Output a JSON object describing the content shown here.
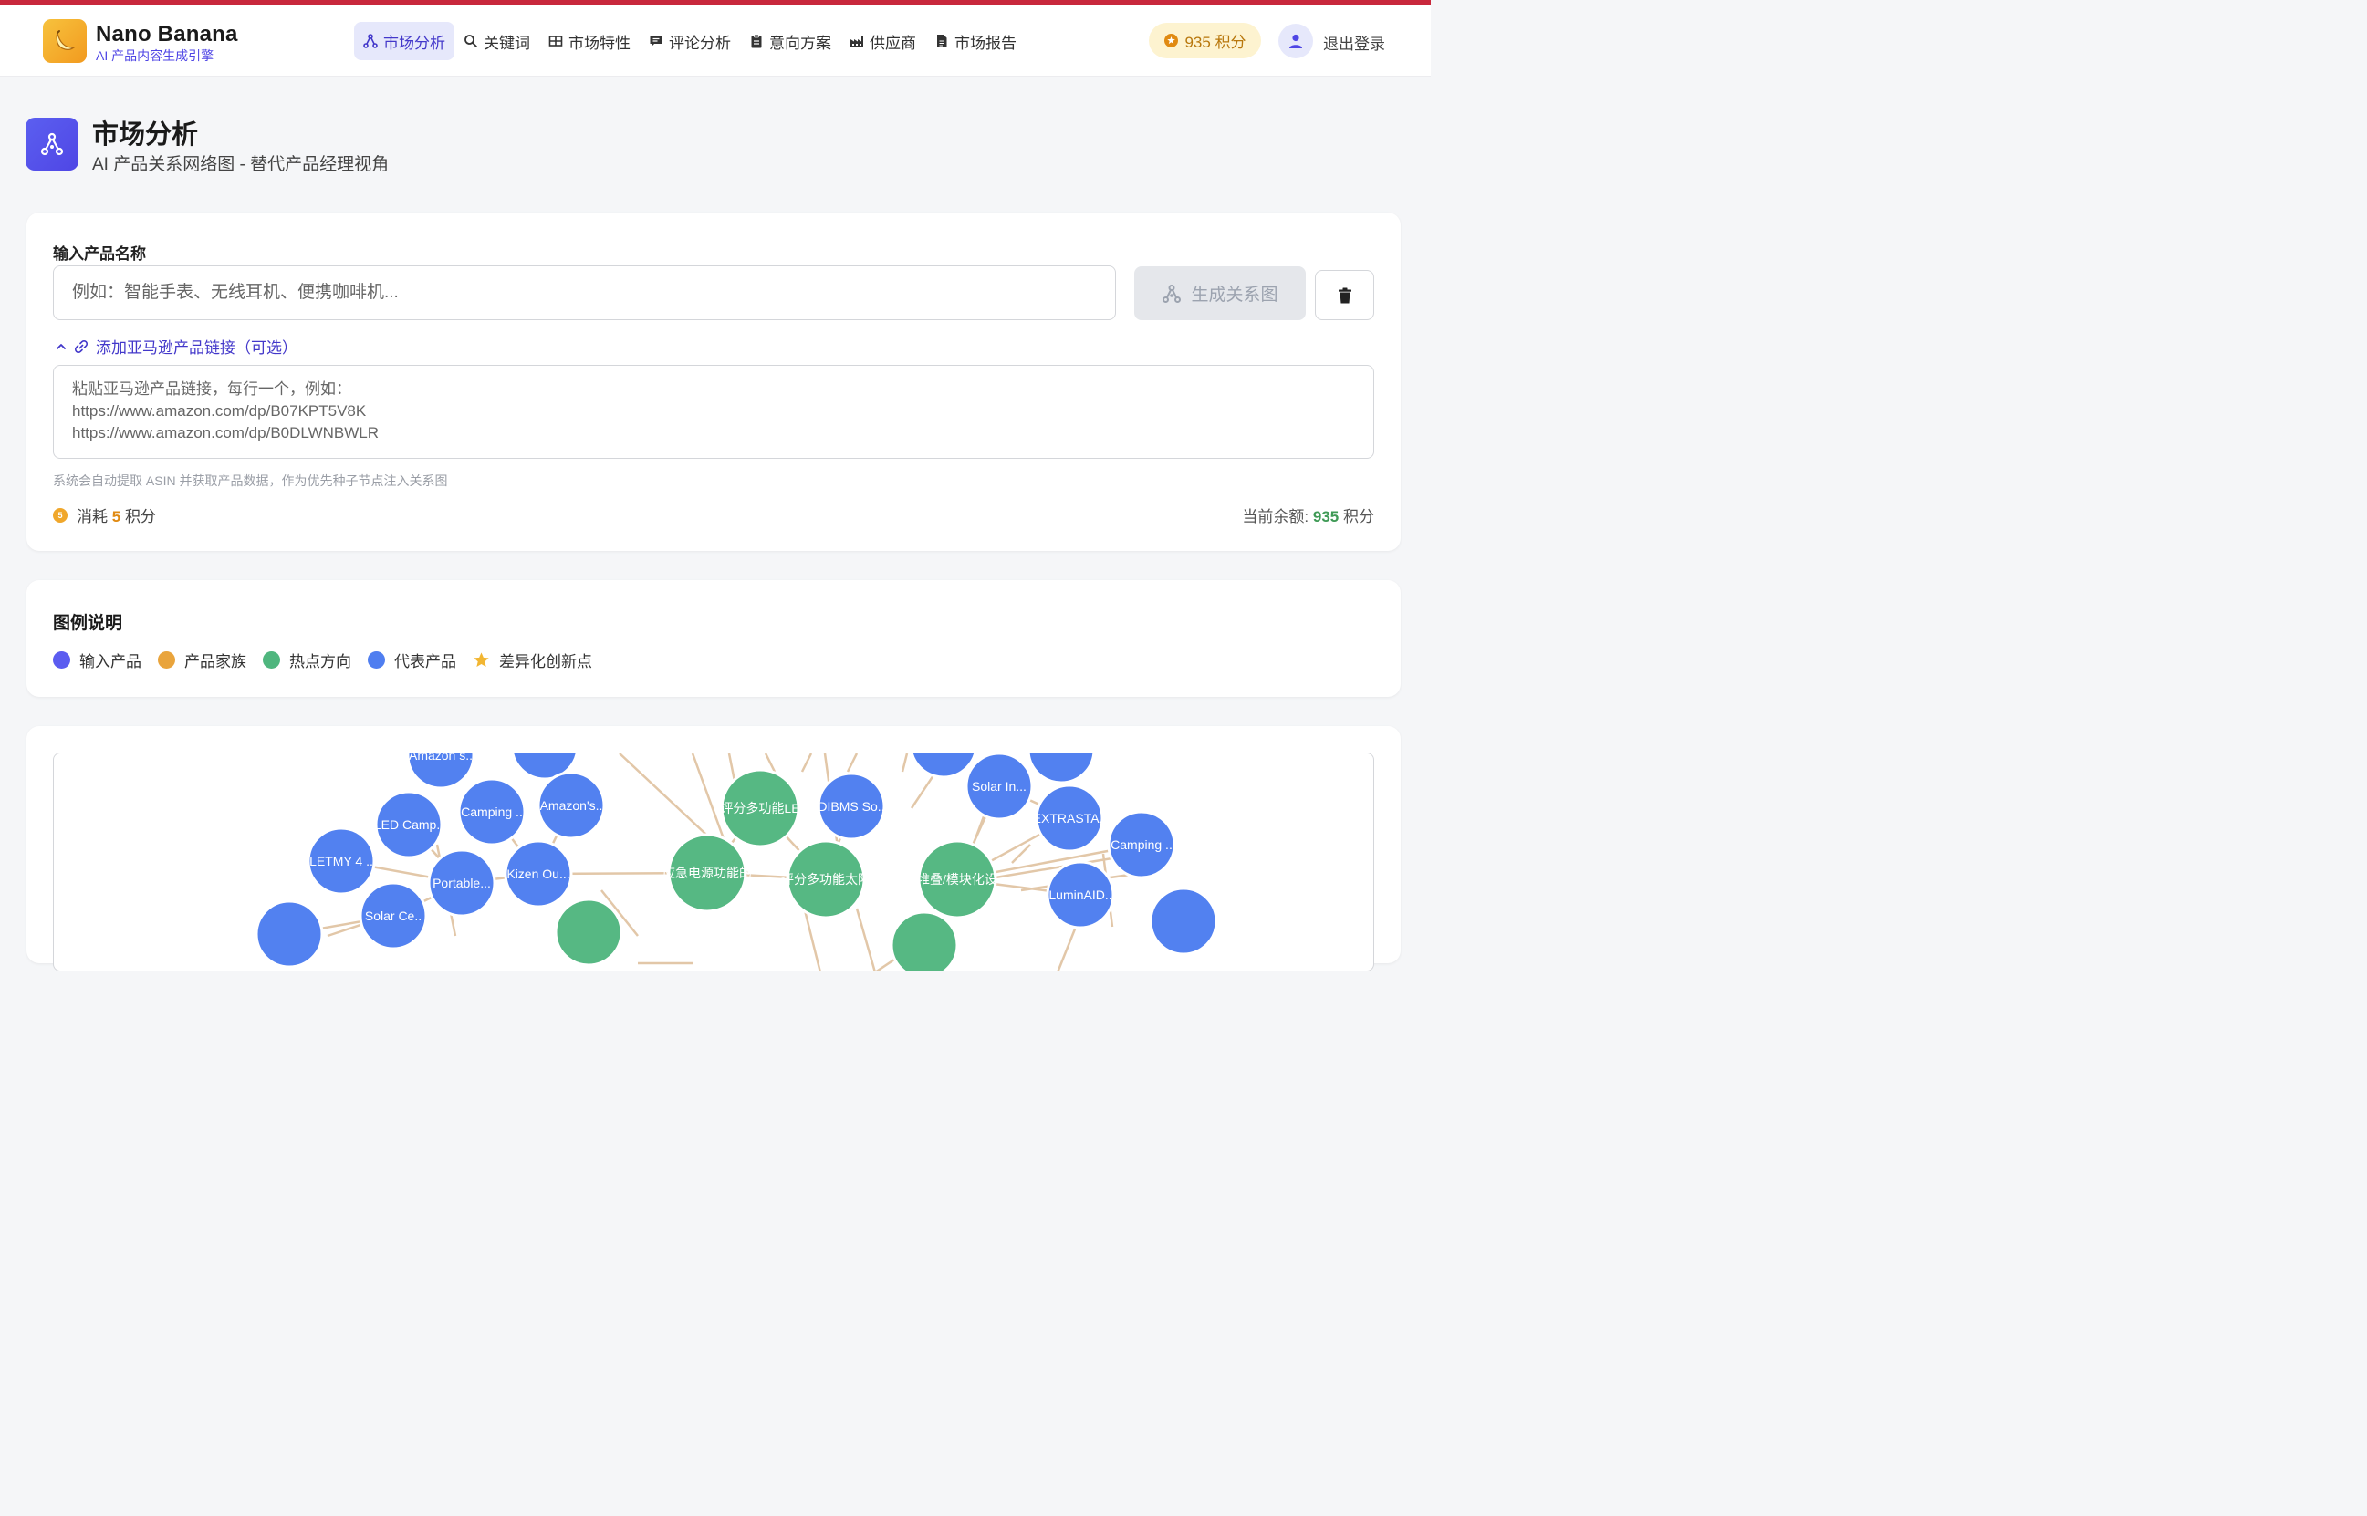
{
  "app": {
    "brand": "Nano Banana",
    "brand_sub": "AI 产品内容生成引擎"
  },
  "nav": {
    "items": [
      {
        "label": "市场分析",
        "icon": "network-icon",
        "active": true
      },
      {
        "label": "关键词",
        "icon": "search-icon",
        "active": false
      },
      {
        "label": "市场特性",
        "icon": "grid-icon",
        "active": false
      },
      {
        "label": "评论分析",
        "icon": "comment-icon",
        "active": false
      },
      {
        "label": "意向方案",
        "icon": "clipboard-icon",
        "active": false
      },
      {
        "label": "供应商",
        "icon": "factory-icon",
        "active": false
      },
      {
        "label": "市场报告",
        "icon": "document-icon",
        "active": false
      }
    ]
  },
  "user": {
    "points_label": "935 积分",
    "logout_label": "退出登录"
  },
  "page": {
    "title": "市场分析",
    "subtitle": "AI 产品关系网络图 - 替代产品经理视角"
  },
  "form": {
    "product_label": "输入产品名称",
    "product_value": "",
    "product_placeholder": "例如：智能手表、无线耳机、便携咖啡机...",
    "generate_label": "生成关系图",
    "amazon_toggle_label": "添加亚马逊产品链接（可选）",
    "links_value": "",
    "links_placeholder": "粘贴亚马逊产品链接，每行一个，例如：\nhttps://www.amazon.com/dp/B07KPT5V8K\nhttps://www.amazon.com/dp/B0DLWNBWLR",
    "hint": "系统会自动提取 ASIN 并获取产品数据，作为优先种子节点注入关系图",
    "cost_prefix": "消耗",
    "cost_value": "5",
    "cost_unit": "积分",
    "coin_glyph": "5",
    "balance_prefix": "当前余额:",
    "balance_value": "935",
    "balance_unit": "积分"
  },
  "legend": {
    "title": "图例说明",
    "items": [
      {
        "label": "输入产品",
        "color": "#5b5cf0"
      },
      {
        "label": "产品家族",
        "color": "#e9a43c"
      },
      {
        "label": "热点方向",
        "color": "#4fb67e"
      },
      {
        "label": "代表产品",
        "color": "#4f7ef0"
      },
      {
        "label": "差异化创新点",
        "color": "#f2b632"
      }
    ]
  },
  "graph": {
    "colors": {
      "hotspot": "#56b883",
      "product": "#5281f0",
      "edge": "#e2c7a8"
    },
    "nodes": [
      {
        "label": "Amazon s..",
        "type": "product"
      },
      {
        "label": "LED Camp..",
        "type": "product"
      },
      {
        "label": "Camping ..",
        "type": "product"
      },
      {
        "label": "Amazon's..",
        "type": "product"
      },
      {
        "label": "LETMY 4 ..",
        "type": "product"
      },
      {
        "label": "Portable...",
        "type": "product"
      },
      {
        "label": "Kizen Ou...",
        "type": "product"
      },
      {
        "label": "Solar Ce..",
        "type": "product"
      },
      {
        "label": "评分多功能LE",
        "type": "hotspot"
      },
      {
        "label": "DIBMS So..",
        "type": "product"
      },
      {
        "label": "应急电源功能的",
        "type": "hotspot"
      },
      {
        "label": "评分多功能太阳",
        "type": "hotspot"
      },
      {
        "label": "Solar In...",
        "type": "product"
      },
      {
        "label": "EXTRASTA..",
        "type": "product"
      },
      {
        "label": "Camping ..",
        "type": "product"
      },
      {
        "label": "堆叠/模块化设",
        "type": "hotspot"
      },
      {
        "label": "LuminAID..",
        "type": "product"
      }
    ]
  }
}
